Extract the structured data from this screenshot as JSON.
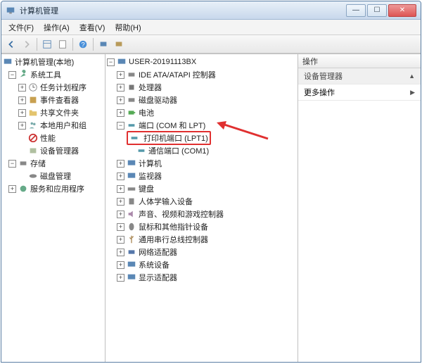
{
  "window": {
    "title": "计算机管理"
  },
  "menu": {
    "file": "文件(F)",
    "action": "操作(A)",
    "view": "查看(V)",
    "help": "帮助(H)"
  },
  "left_tree": {
    "root": "计算机管理(本地)",
    "system_tools": "系统工具",
    "task_scheduler": "任务计划程序",
    "event_viewer": "事件查看器",
    "shared_folders": "共享文件夹",
    "local_users": "本地用户和组",
    "performance": "性能",
    "device_manager": "设备管理器",
    "storage": "存储",
    "disk_mgmt": "磁盘管理",
    "services_apps": "服务和应用程序"
  },
  "mid_tree": {
    "root": "USER-20191113BX",
    "ide": "IDE ATA/ATAPI 控制器",
    "cpu": "处理器",
    "diskdrv": "磁盘驱动器",
    "battery": "电池",
    "ports": "端口 (COM 和 LPT)",
    "lpt1": "打印机端口 (LPT1)",
    "com1": "通信端口 (COM1)",
    "computer": "计算机",
    "monitor": "监视器",
    "keyboard": "键盘",
    "hid": "人体学输入设备",
    "sound": "声音、视频和游戏控制器",
    "mouse": "鼠标和其他指针设备",
    "usb": "通用串行总线控制器",
    "network": "网络适配器",
    "sysdev": "系统设备",
    "display": "显示适配器"
  },
  "right": {
    "header": "操作",
    "device_mgr": "设备管理器",
    "more_actions": "更多操作"
  }
}
